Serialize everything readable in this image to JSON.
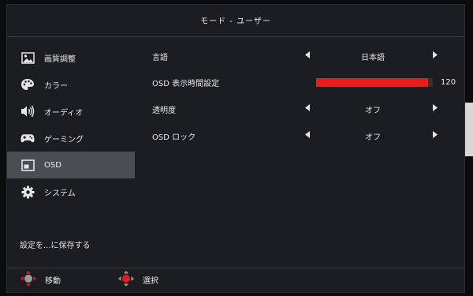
{
  "window": {
    "title": "モード - ユーザー"
  },
  "sidebar": {
    "items": [
      {
        "label": "画質調整",
        "icon": "picture-icon",
        "active": false
      },
      {
        "label": "カラー",
        "icon": "palette-icon",
        "active": false
      },
      {
        "label": "オーディオ",
        "icon": "speaker-icon",
        "active": false
      },
      {
        "label": "ゲーミング",
        "icon": "gamepad-icon",
        "active": false
      },
      {
        "label": "OSD",
        "icon": "osd-icon",
        "active": true
      },
      {
        "label": "システム",
        "icon": "gear-icon",
        "active": false
      }
    ],
    "save_label": "設定を...に保存する"
  },
  "settings": [
    {
      "label": "言語",
      "value": "日本語"
    },
    {
      "label": "OSD 表示時間設定",
      "value": "120",
      "level": 0.957
    },
    {
      "label": "透明度",
      "value": "オフ"
    },
    {
      "label": "OSD ロック",
      "value": "オフ"
    }
  ],
  "footer": {
    "move_label": "移動",
    "select_label": "選択"
  },
  "colors": {
    "accent": "#ec1b1b",
    "active_item": "#4a4d52",
    "panel": "#1c1d20"
  }
}
